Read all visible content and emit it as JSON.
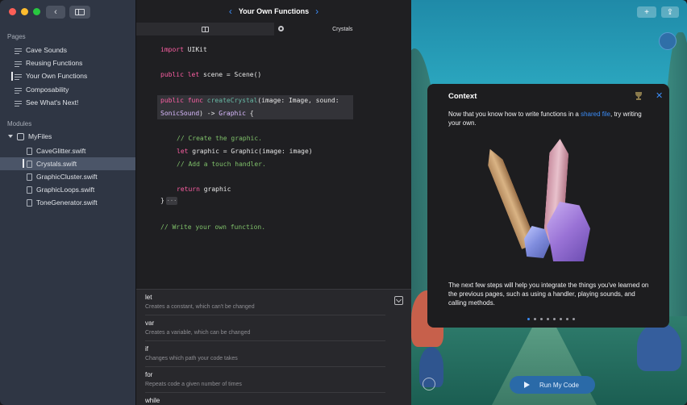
{
  "sidebar": {
    "pages_title": "Pages",
    "pages": [
      "Cave Sounds",
      "Reusing Functions",
      "Your Own Functions",
      "Composability",
      "See What's Next!"
    ],
    "modules_title": "Modules",
    "module_name": "MyFiles",
    "files": [
      "CaveGlitter.swift",
      "Crystals.swift",
      "GraphicCluster.swift",
      "GraphicLoops.swift",
      "ToneGenerator.swift"
    ]
  },
  "editor": {
    "title": "Your Own Functions",
    "tab_crystals": "Crystals",
    "code": {
      "l1_kw": "import",
      "l1_rest": " UIKit",
      "l2_kw": "public let",
      "l2_rest": " scene = Scene()",
      "l3_kw": "public func",
      "l3_fn": " createCrystal",
      "l3_rest": "(image: Image, sound:",
      "l4_tp": "SonicSound",
      "l4_rest": ") -> ",
      "l4_tp2": "Graphic",
      "l4_end": " {",
      "l5_cm": "// Create the graphic.",
      "l6_kw": "let",
      "l6_rest": " graphic = Graphic(image: image)",
      "l7_cm": "// Add a touch handler.",
      "l8_kw": "return",
      "l8_rest": " graphic",
      "l9": "}",
      "fold": "···",
      "l10_cm": "// Write your own function."
    },
    "completions": [
      {
        "keyword": "let",
        "desc": "Creates a constant, which can't be changed"
      },
      {
        "keyword": "var",
        "desc": "Creates a variable, which can be changed"
      },
      {
        "keyword": "if",
        "desc": "Changes which path your code takes"
      },
      {
        "keyword": "for",
        "desc": "Repeats code a given number of times"
      },
      {
        "keyword": "while",
        "desc": ""
      }
    ]
  },
  "live": {
    "popover": {
      "title": "Context",
      "text_before": "Now that you know how to write functions in a ",
      "link": "shared file",
      "text_after": ", try writing your own.",
      "body": "The next few steps will help you integrate the things you've learned on the previous pages, such as using a handler, playing sounds, and calling methods.",
      "page_count": 8,
      "active_page": 1
    },
    "run_label": "Run My Code"
  },
  "colors": {
    "accent": "#3b8cf7",
    "keyword": "#fc5fa3",
    "comment": "#7fc06a",
    "sidebar": "#2f3644"
  }
}
